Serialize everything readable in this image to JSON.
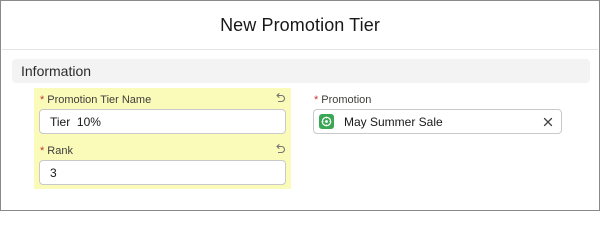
{
  "modal": {
    "title": "New Promotion Tier"
  },
  "section": {
    "title": "Information"
  },
  "fields": {
    "tier_name": {
      "required_marker": "*",
      "label": "Promotion Tier Name",
      "value": "Tier  10%"
    },
    "rank": {
      "required_marker": "*",
      "label": "Rank",
      "value": "3"
    },
    "promotion": {
      "required_marker": "*",
      "label": "Promotion",
      "value": "May Summer Sale",
      "icon": "promotion-icon"
    }
  },
  "colors": {
    "required": "#c23934",
    "highlight": "#fafab9",
    "section_bg": "#f3f3f3",
    "promotion_icon_bg": "#3ba755"
  }
}
